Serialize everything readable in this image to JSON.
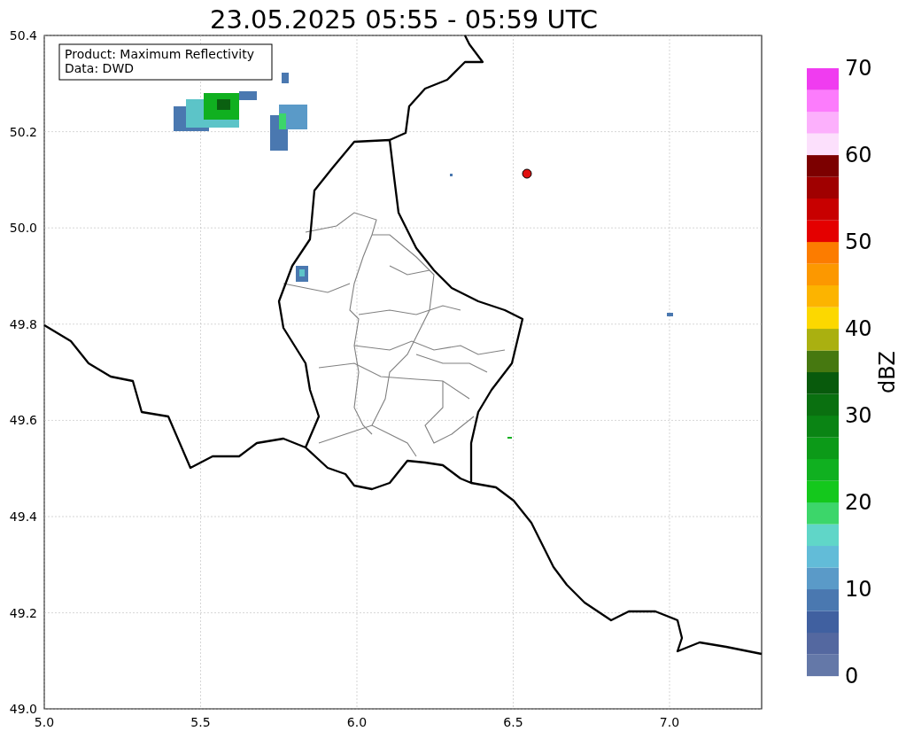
{
  "title": "23.05.2025 05:55 - 05:59 UTC",
  "info_box": [
    "Product: Maximum Reflectivity",
    "Data: DWD"
  ],
  "y_ticks": [
    "50.4",
    "50.2",
    "50.0",
    "49.8",
    "49.6",
    "49.4",
    "49.2",
    "49.0"
  ],
  "x_ticks": [
    "5.0",
    "5.5",
    "6.0",
    "6.5",
    "7.0"
  ],
  "colorbar": {
    "label": "dBZ",
    "ticks": [
      "70",
      "60",
      "50",
      "40",
      "30",
      "20",
      "10",
      "0"
    ]
  }
}
